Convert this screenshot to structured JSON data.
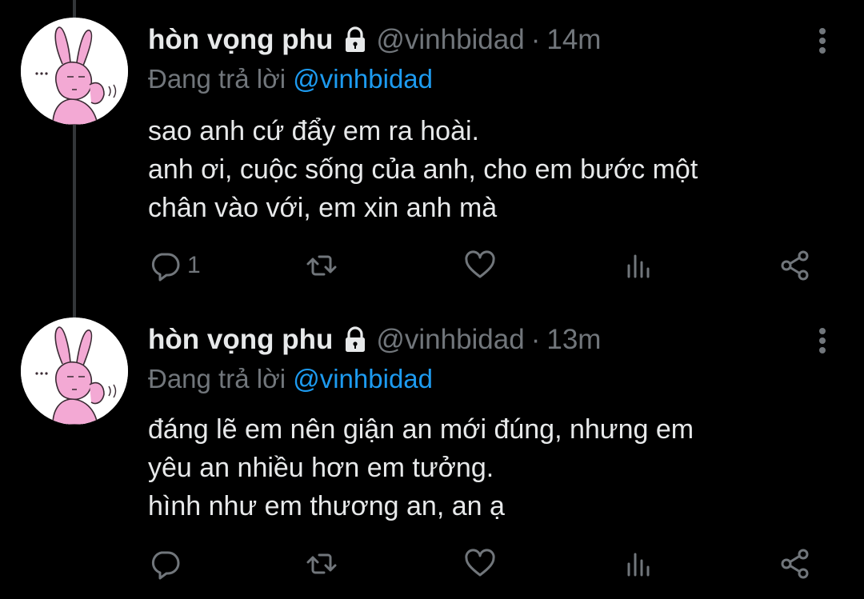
{
  "colors": {
    "background": "#000000",
    "text_primary": "#e7e9ea",
    "text_secondary": "#71767b",
    "accent": "#1d9bf0",
    "thread_line": "#333639"
  },
  "tweets": [
    {
      "author_name": "hòn vọng phu",
      "protected_icon": "lock-icon",
      "handle": "@vinhbidad",
      "separator": "·",
      "time": "14m",
      "replying_prefix": "Đang trả lời",
      "replying_to": "@vinhbidad",
      "lines": [
        "sao anh cứ đẩy em ra hoài.",
        "anh ơi, cuộc sống của anh, cho em bước một",
        "chân vào với, em xin anh mà"
      ],
      "reply_count": "1",
      "icons": [
        "more-icon",
        "reply-icon",
        "retweet-icon",
        "like-icon",
        "stats-icon",
        "share-icon"
      ]
    },
    {
      "author_name": "hòn vọng phu",
      "protected_icon": "lock-icon",
      "handle": "@vinhbidad",
      "separator": "·",
      "time": "13m",
      "replying_prefix": "Đang trả lời",
      "replying_to": "@vinhbidad",
      "lines": [
        "đáng lẽ em nên giận an mới đúng, nhưng em",
        "yêu an nhiều hơn em tưởng.",
        "hình như em thương an, an ạ"
      ],
      "reply_count": "",
      "icons": [
        "more-icon",
        "reply-icon",
        "retweet-icon",
        "like-icon",
        "stats-icon",
        "share-icon"
      ]
    }
  ]
}
